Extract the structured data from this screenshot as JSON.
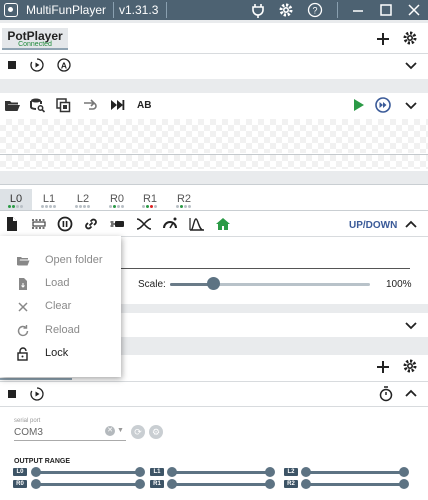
{
  "window": {
    "app_name": "MultiFunPlayer",
    "version": "v1.31.3",
    "icons": [
      "plug-icon",
      "gear-icon",
      "help-icon",
      "minimize-icon",
      "maximize-icon",
      "close-icon"
    ]
  },
  "media_source": {
    "tab_name": "PotPlayer",
    "tab_status": "Connected"
  },
  "axes": {
    "tabs": [
      {
        "label": "L0",
        "active": true
      },
      {
        "label": "L1",
        "active": false
      },
      {
        "label": "L2",
        "active": false
      },
      {
        "label": "R0",
        "active": false
      },
      {
        "label": "R1",
        "active": false
      },
      {
        "label": "R2",
        "active": false
      }
    ],
    "mode_label": "UP/DOWN"
  },
  "playlist": {
    "ab_label": "AB"
  },
  "scale": {
    "label": "Scale:",
    "value_text": "100%",
    "value": 0.2
  },
  "context_menu": {
    "items": [
      {
        "label": "Open folder",
        "icon": "folder-open-icon",
        "enabled": false
      },
      {
        "label": "Load",
        "icon": "file-load-icon",
        "enabled": false
      },
      {
        "label": "Clear",
        "icon": "clear-icon",
        "enabled": false
      },
      {
        "label": "Reload",
        "icon": "reload-icon",
        "enabled": false
      },
      {
        "label": "Lock",
        "icon": "lock-icon",
        "enabled": true
      }
    ]
  },
  "output": {
    "serial_port_label": "serial port",
    "serial_port_value": "COM3",
    "range_title": "OUTPUT RANGE",
    "ranges": [
      {
        "axis": "L0"
      },
      {
        "axis": "R0"
      },
      {
        "axis": "L1"
      },
      {
        "axis": "R1"
      },
      {
        "axis": "L2"
      },
      {
        "axis": "R2"
      }
    ]
  },
  "colors": {
    "titlebar": "#4d6272",
    "accent": "#3a5a98",
    "connected": "#1e8a3a",
    "play": "#2b9a46",
    "slider": "#5d7383"
  }
}
